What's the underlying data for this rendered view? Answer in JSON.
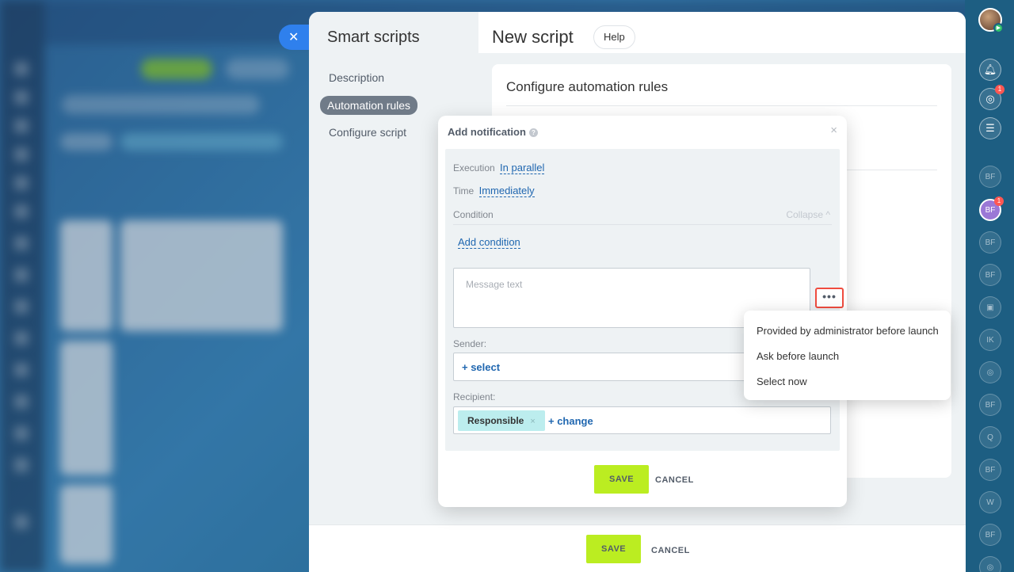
{
  "slider": {
    "title": "Smart scripts",
    "nav": [
      "Description",
      "Automation rules",
      "Configure script"
    ]
  },
  "header": {
    "title": "New script",
    "help_label": "Help"
  },
  "card": {
    "title": "Configure automation rules"
  },
  "footer": {
    "save_label": "SAVE",
    "cancel_label": "CANCEL"
  },
  "dialog": {
    "title": "Add notification",
    "close": "×",
    "execution_label": "Execution",
    "execution_value": "In parallel",
    "time_label": "Time",
    "time_value": "Immediately",
    "condition_label": "Condition",
    "collapse_label": "Collapse ^",
    "add_condition": "Add condition",
    "message_placeholder": "Message text",
    "dots": "•••",
    "sender_label": "Sender:",
    "sender_select": "+ select",
    "recipient_label": "Recipient:",
    "recipient_tag": "Responsible",
    "recipient_tag_remove": "×",
    "recipient_change": "+ change",
    "save_label": "SAVE",
    "cancel_label": "CANCEL"
  },
  "menu": {
    "items": [
      "Provided by administrator before launch",
      "Ask before launch",
      "Select now"
    ]
  },
  "rail": {
    "items": [
      "BF",
      "BF",
      "BF",
      "BF",
      "IK",
      "BF",
      "Q",
      "BF",
      "W",
      "BF"
    ],
    "badge": "1"
  },
  "colors": {
    "accent_green": "#bbed21",
    "link_blue": "#2067b0",
    "close_tab_blue": "#2f80ed",
    "highlight_red": "#ef4c3f"
  }
}
